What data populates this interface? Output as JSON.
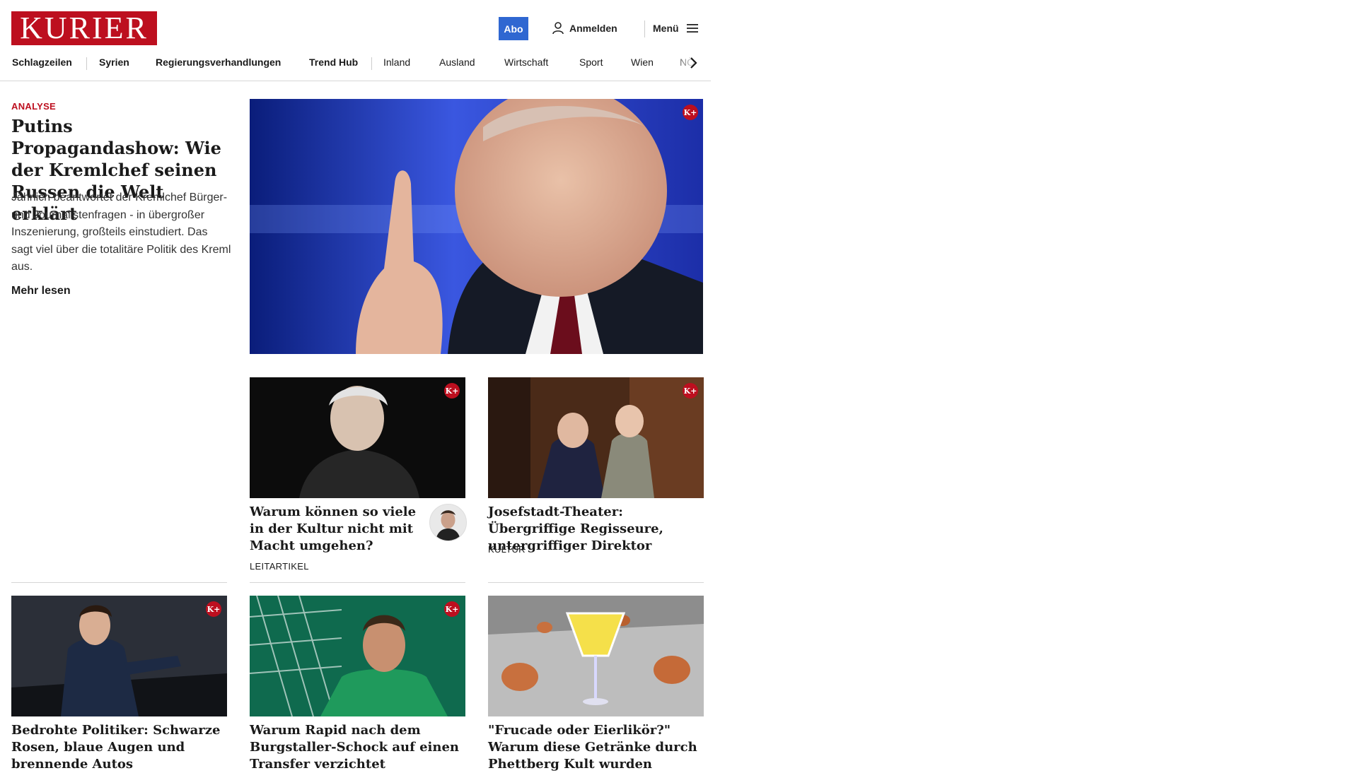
{
  "header": {
    "logo_text": "KURIER",
    "abo_label": "Abo",
    "login_label": "Anmelden",
    "menu_label": "Menü"
  },
  "nav": {
    "items": [
      {
        "label": "Schlagzeilen",
        "bold": true
      },
      {
        "label": "Syrien",
        "bold": true
      },
      {
        "label": "Regierungsverhandlungen",
        "bold": true
      },
      {
        "label": "Trend Hub",
        "bold": true
      },
      {
        "label": "Inland",
        "bold": false
      },
      {
        "label": "Ausland",
        "bold": false
      },
      {
        "label": "Wirtschaft",
        "bold": false
      },
      {
        "label": "Sport",
        "bold": false
      },
      {
        "label": "Wien",
        "bold": false
      },
      {
        "label": "NÖ",
        "bold": false
      }
    ]
  },
  "lead": {
    "kicker": "ANALYSE",
    "title": "Putins Propagandashow: Wie der Kremlchef seinen Russen die Welt erklärt",
    "teaser": "Jährlich beantwortet der Kremlchef Bürger- und Journalistenfragen - in übergroßer Inszenierung, großteils einstudiert. Das sagt viel über die totalitäre Politik des Kreml aus.",
    "read_more": "Mehr lesen",
    "badge": "K+"
  },
  "cards": [
    {
      "title": "Warum können so viele in der Kultur nicht mit Macht umgehen?",
      "tag": "LEITARTIKEL",
      "badge": "K+"
    },
    {
      "title": "Josefstadt-Theater: Übergriffige Regisseure, untergriffiger Direktor",
      "tag": "KULTUR",
      "badge": "K+"
    },
    {
      "title": "Bedrohte Politiker: Schwarze Rosen, blaue Augen und brennende Autos",
      "tag": "",
      "badge": "K+"
    },
    {
      "title": "Warum Rapid nach dem Burgstaller-Schock auf einen Transfer verzichtet",
      "tag": "",
      "badge": "K+"
    },
    {
      "title": "\"Frucade oder Eierlikör?\" Warum diese Getränke durch Phettberg Kult wurden",
      "tag": "",
      "badge": ""
    }
  ],
  "colors": {
    "brand_red": "#bd0f1f",
    "abo_blue": "#2f67d1"
  },
  "icons": {
    "login": "user-icon",
    "menu": "hamburger-icon",
    "nav_next": "chevron-right-icon",
    "premium": "kplus-badge-icon"
  }
}
